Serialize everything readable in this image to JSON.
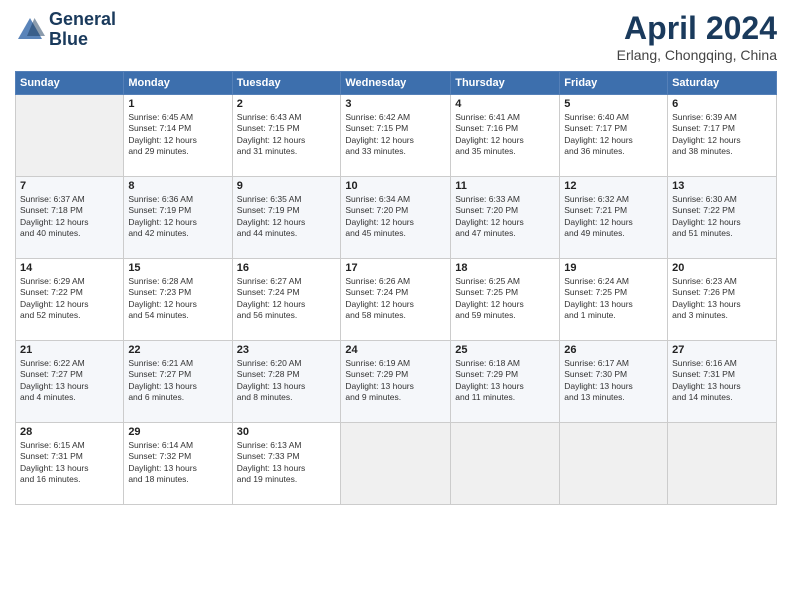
{
  "header": {
    "logo_line1": "General",
    "logo_line2": "Blue",
    "main_title": "April 2024",
    "subtitle": "Erlang, Chongqing, China"
  },
  "days_of_week": [
    "Sunday",
    "Monday",
    "Tuesday",
    "Wednesday",
    "Thursday",
    "Friday",
    "Saturday"
  ],
  "weeks": [
    [
      {
        "day": "",
        "info": ""
      },
      {
        "day": "1",
        "info": "Sunrise: 6:45 AM\nSunset: 7:14 PM\nDaylight: 12 hours\nand 29 minutes."
      },
      {
        "day": "2",
        "info": "Sunrise: 6:43 AM\nSunset: 7:15 PM\nDaylight: 12 hours\nand 31 minutes."
      },
      {
        "day": "3",
        "info": "Sunrise: 6:42 AM\nSunset: 7:15 PM\nDaylight: 12 hours\nand 33 minutes."
      },
      {
        "day": "4",
        "info": "Sunrise: 6:41 AM\nSunset: 7:16 PM\nDaylight: 12 hours\nand 35 minutes."
      },
      {
        "day": "5",
        "info": "Sunrise: 6:40 AM\nSunset: 7:17 PM\nDaylight: 12 hours\nand 36 minutes."
      },
      {
        "day": "6",
        "info": "Sunrise: 6:39 AM\nSunset: 7:17 PM\nDaylight: 12 hours\nand 38 minutes."
      }
    ],
    [
      {
        "day": "7",
        "info": "Sunrise: 6:37 AM\nSunset: 7:18 PM\nDaylight: 12 hours\nand 40 minutes."
      },
      {
        "day": "8",
        "info": "Sunrise: 6:36 AM\nSunset: 7:19 PM\nDaylight: 12 hours\nand 42 minutes."
      },
      {
        "day": "9",
        "info": "Sunrise: 6:35 AM\nSunset: 7:19 PM\nDaylight: 12 hours\nand 44 minutes."
      },
      {
        "day": "10",
        "info": "Sunrise: 6:34 AM\nSunset: 7:20 PM\nDaylight: 12 hours\nand 45 minutes."
      },
      {
        "day": "11",
        "info": "Sunrise: 6:33 AM\nSunset: 7:20 PM\nDaylight: 12 hours\nand 47 minutes."
      },
      {
        "day": "12",
        "info": "Sunrise: 6:32 AM\nSunset: 7:21 PM\nDaylight: 12 hours\nand 49 minutes."
      },
      {
        "day": "13",
        "info": "Sunrise: 6:30 AM\nSunset: 7:22 PM\nDaylight: 12 hours\nand 51 minutes."
      }
    ],
    [
      {
        "day": "14",
        "info": "Sunrise: 6:29 AM\nSunset: 7:22 PM\nDaylight: 12 hours\nand 52 minutes."
      },
      {
        "day": "15",
        "info": "Sunrise: 6:28 AM\nSunset: 7:23 PM\nDaylight: 12 hours\nand 54 minutes."
      },
      {
        "day": "16",
        "info": "Sunrise: 6:27 AM\nSunset: 7:24 PM\nDaylight: 12 hours\nand 56 minutes."
      },
      {
        "day": "17",
        "info": "Sunrise: 6:26 AM\nSunset: 7:24 PM\nDaylight: 12 hours\nand 58 minutes."
      },
      {
        "day": "18",
        "info": "Sunrise: 6:25 AM\nSunset: 7:25 PM\nDaylight: 12 hours\nand 59 minutes."
      },
      {
        "day": "19",
        "info": "Sunrise: 6:24 AM\nSunset: 7:25 PM\nDaylight: 13 hours\nand 1 minute."
      },
      {
        "day": "20",
        "info": "Sunrise: 6:23 AM\nSunset: 7:26 PM\nDaylight: 13 hours\nand 3 minutes."
      }
    ],
    [
      {
        "day": "21",
        "info": "Sunrise: 6:22 AM\nSunset: 7:27 PM\nDaylight: 13 hours\nand 4 minutes."
      },
      {
        "day": "22",
        "info": "Sunrise: 6:21 AM\nSunset: 7:27 PM\nDaylight: 13 hours\nand 6 minutes."
      },
      {
        "day": "23",
        "info": "Sunrise: 6:20 AM\nSunset: 7:28 PM\nDaylight: 13 hours\nand 8 minutes."
      },
      {
        "day": "24",
        "info": "Sunrise: 6:19 AM\nSunset: 7:29 PM\nDaylight: 13 hours\nand 9 minutes."
      },
      {
        "day": "25",
        "info": "Sunrise: 6:18 AM\nSunset: 7:29 PM\nDaylight: 13 hours\nand 11 minutes."
      },
      {
        "day": "26",
        "info": "Sunrise: 6:17 AM\nSunset: 7:30 PM\nDaylight: 13 hours\nand 13 minutes."
      },
      {
        "day": "27",
        "info": "Sunrise: 6:16 AM\nSunset: 7:31 PM\nDaylight: 13 hours\nand 14 minutes."
      }
    ],
    [
      {
        "day": "28",
        "info": "Sunrise: 6:15 AM\nSunset: 7:31 PM\nDaylight: 13 hours\nand 16 minutes."
      },
      {
        "day": "29",
        "info": "Sunrise: 6:14 AM\nSunset: 7:32 PM\nDaylight: 13 hours\nand 18 minutes."
      },
      {
        "day": "30",
        "info": "Sunrise: 6:13 AM\nSunset: 7:33 PM\nDaylight: 13 hours\nand 19 minutes."
      },
      {
        "day": "",
        "info": ""
      },
      {
        "day": "",
        "info": ""
      },
      {
        "day": "",
        "info": ""
      },
      {
        "day": "",
        "info": ""
      }
    ]
  ]
}
